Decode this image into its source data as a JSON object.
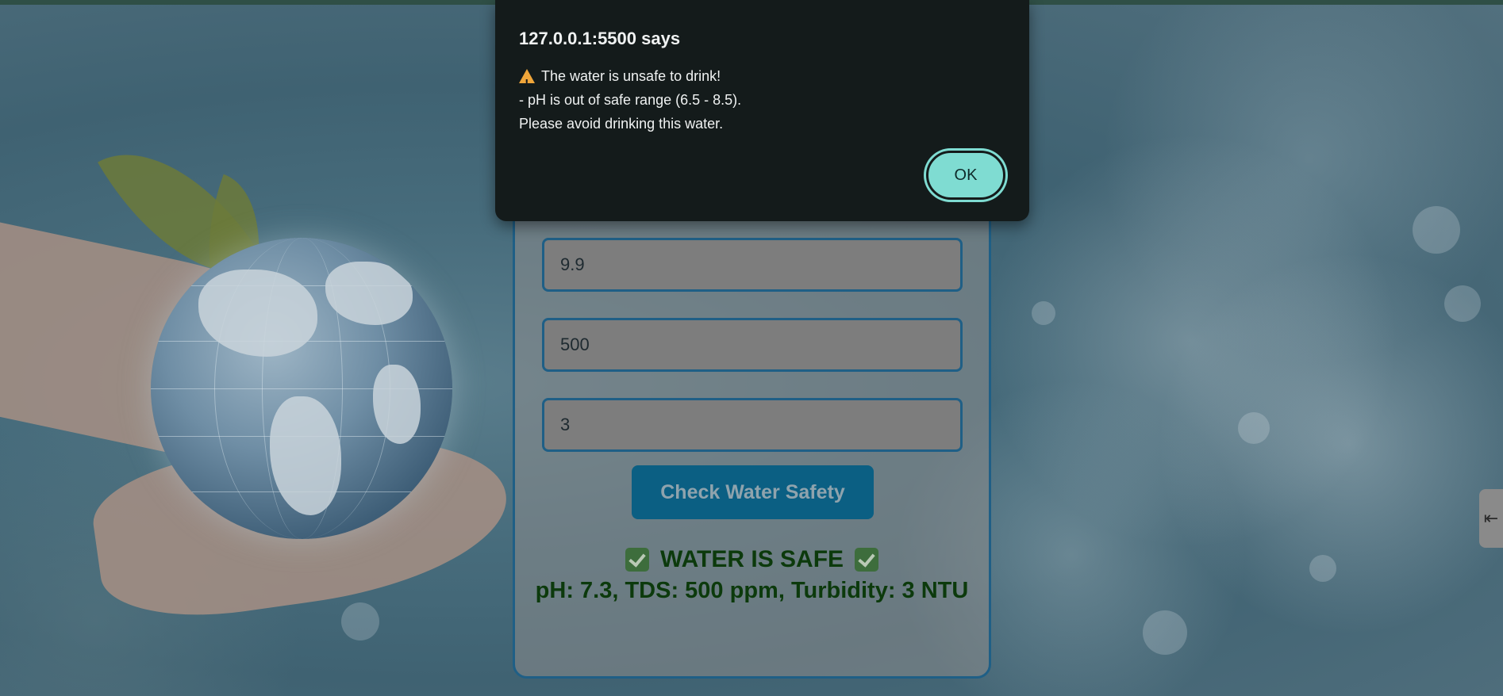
{
  "form": {
    "fields": [
      {
        "name": "ph",
        "value": "9.9"
      },
      {
        "name": "tds",
        "value": "500"
      },
      {
        "name": "turbidity",
        "value": "3"
      }
    ],
    "check_button_label": "Check Water Safety",
    "result": {
      "headline": "WATER IS SAFE",
      "details": "pH: 7.3, TDS: 500 ppm, Turbidity: 3 NTU"
    }
  },
  "alert": {
    "title": "127.0.0.1:5500 says",
    "line1": "The water is unsafe to drink!",
    "line2": "- pH is out of safe range (6.5 - 8.5).",
    "line3": "Please avoid drinking this water.",
    "ok_label": "OK"
  },
  "icons": {
    "warning": "warning-icon",
    "check": "check-mark-icon",
    "side_tab": "collapse-icon"
  },
  "colors": {
    "dialog_bg": "#141b1b",
    "ok_button": "#7fdcd2",
    "card_border": "#1f5f86",
    "check_button": "#0b5f83",
    "result_text": "#0c3a0c"
  }
}
